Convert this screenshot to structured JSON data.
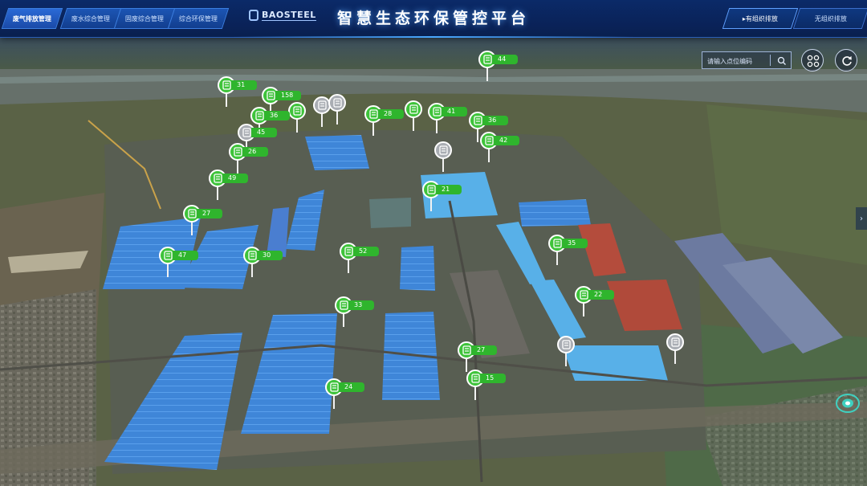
{
  "nav": {
    "left_tabs": [
      "废气排放管理",
      "废水综合管理",
      "固废综合管理",
      "综合环保管理"
    ],
    "logo_text": "BAOSTEEL",
    "title": "智慧生态环保管控平台",
    "right_tabs": [
      "▸有组织排放",
      "无组织排放"
    ]
  },
  "search": {
    "placeholder": "请输入点位编码"
  },
  "markers": [
    {
      "label": "31",
      "status": "normal"
    },
    {
      "label": "158",
      "status": "normal"
    },
    {
      "label": "",
      "status": "offline"
    },
    {
      "label": "",
      "status": "offline"
    },
    {
      "label": "",
      "status": "normal"
    },
    {
      "label": "28",
      "status": "normal"
    },
    {
      "label": "",
      "status": "normal"
    },
    {
      "label": "41",
      "status": "normal"
    },
    {
      "label": "36",
      "status": "normal"
    },
    {
      "label": "36",
      "status": "normal"
    },
    {
      "label": "45",
      "status": "offline"
    },
    {
      "label": "26",
      "status": "normal"
    },
    {
      "label": "42",
      "status": "normal"
    },
    {
      "label": "",
      "status": "offline"
    },
    {
      "label": "49",
      "status": "normal"
    },
    {
      "label": "21",
      "status": "normal"
    },
    {
      "label": "27",
      "status": "normal"
    },
    {
      "label": "35",
      "status": "normal"
    },
    {
      "label": "47",
      "status": "normal"
    },
    {
      "label": "30",
      "status": "normal"
    },
    {
      "label": "52",
      "status": "normal"
    },
    {
      "label": "22",
      "status": "normal"
    },
    {
      "label": "33",
      "status": "normal"
    },
    {
      "label": "",
      "status": "offline"
    },
    {
      "label": "",
      "status": "offline"
    },
    {
      "label": "27",
      "status": "normal"
    },
    {
      "label": "15",
      "status": "normal"
    },
    {
      "label": "24",
      "status": "normal"
    },
    {
      "label": "44",
      "status": "normal"
    }
  ]
}
